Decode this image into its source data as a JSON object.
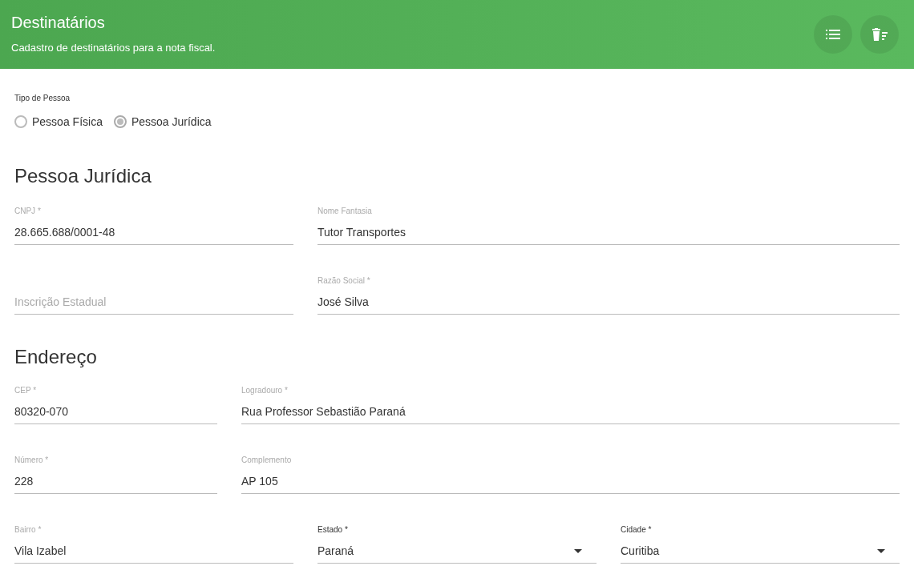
{
  "header": {
    "title": "Destinatários",
    "subtitle": "Cadastro de destinatários para a nota fiscal.",
    "actions": [
      {
        "kind": "list"
      },
      {
        "kind": "delete-sweep"
      }
    ]
  },
  "person_type": {
    "label": "Tipo de Pessoa",
    "options": [
      {
        "label": "Pessoa Física",
        "selected": false
      },
      {
        "label": "Pessoa Jurídica",
        "selected": true
      }
    ]
  },
  "sections": [
    {
      "title": "Pessoa Jurídica",
      "rows": [
        {
          "fields": [
            {
              "kind": "text",
              "label": "CNPJ *",
              "value": "28.665.688/0001-48"
            },
            {
              "kind": "text",
              "label": "Nome Fantasia",
              "value": "Tutor Transportes"
            }
          ]
        },
        {
          "fields": [
            {
              "kind": "text",
              "placeholder": "Inscrição Estadual"
            },
            {
              "kind": "text",
              "label": "Razão Social *",
              "value": "José Silva"
            }
          ]
        }
      ]
    },
    {
      "title": "Endereço",
      "rows": [
        {
          "fields": [
            {
              "kind": "text",
              "label": "CEP *",
              "value": "80320-070"
            },
            {
              "kind": "text",
              "label": "Logradouro *",
              "value": "Rua Professor Sebastião Paraná"
            }
          ]
        },
        {
          "fields": [
            {
              "kind": "text",
              "label": "Número *",
              "value": "228"
            },
            {
              "kind": "text",
              "label": "Complemento",
              "value": "AP 105"
            }
          ]
        },
        {
          "fields": [
            {
              "kind": "text",
              "label": "Bairro *",
              "value": "Vila Izabel"
            },
            {
              "kind": "select",
              "label": "Estado *",
              "value": "Paraná"
            },
            {
              "kind": "select",
              "label": "Cidade *",
              "value": "Curitiba"
            }
          ]
        }
      ]
    }
  ]
}
